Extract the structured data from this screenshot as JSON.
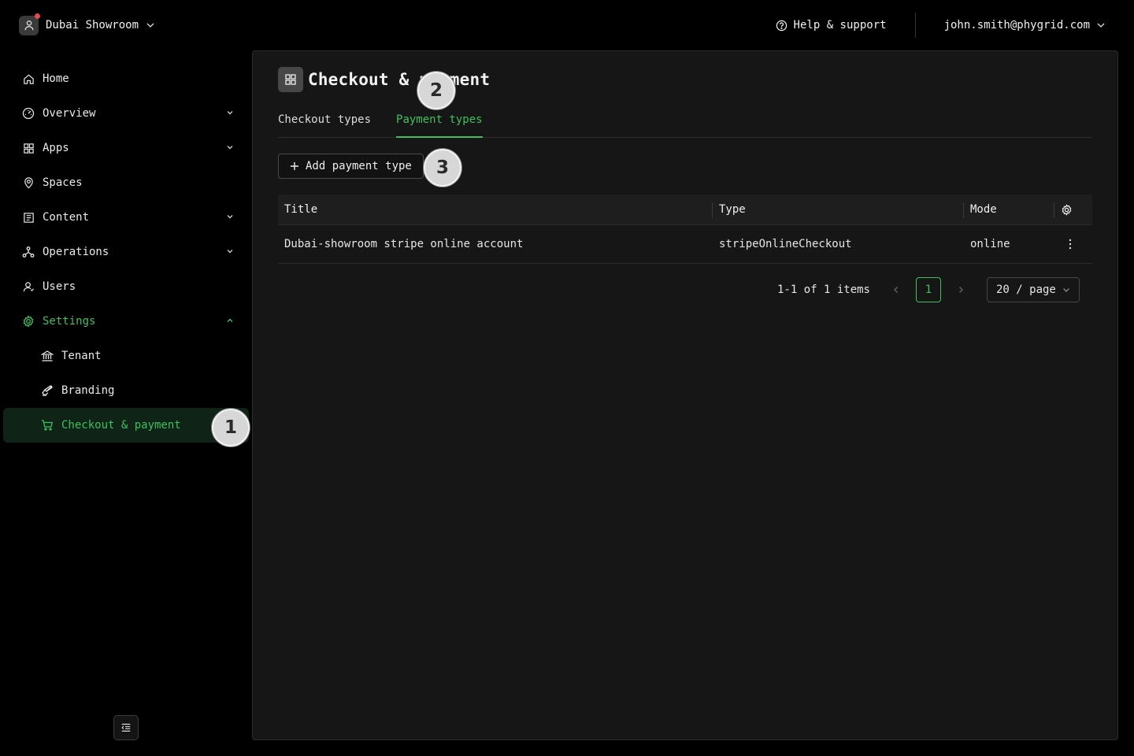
{
  "topbar": {
    "tenant_name": "Dubai Showroom",
    "help_label": "Help & support",
    "user_email": "john.smith@phygrid.com"
  },
  "sidebar": {
    "items": [
      {
        "label": "Home",
        "icon": "home-icon"
      },
      {
        "label": "Overview",
        "icon": "dashboard-icon",
        "expandable": true
      },
      {
        "label": "Apps",
        "icon": "apps-icon",
        "expandable": true
      },
      {
        "label": "Spaces",
        "icon": "location-pin-icon"
      },
      {
        "label": "Content",
        "icon": "content-icon",
        "expandable": true
      },
      {
        "label": "Operations",
        "icon": "operations-icon",
        "expandable": true
      },
      {
        "label": "Users",
        "icon": "users-icon"
      },
      {
        "label": "Settings",
        "icon": "gear-icon",
        "expanded": true
      }
    ],
    "settings_children": [
      {
        "label": "Tenant",
        "icon": "bank-icon"
      },
      {
        "label": "Branding",
        "icon": "brush-icon"
      },
      {
        "label": "Checkout & payment",
        "icon": "cart-icon",
        "active": true
      }
    ]
  },
  "main": {
    "page_title": "Checkout & payment",
    "tabs": [
      {
        "label": "Checkout types",
        "active": false
      },
      {
        "label": "Payment types",
        "active": true
      }
    ],
    "add_button_label": "Add payment type",
    "table": {
      "columns": [
        "Title",
        "Type",
        "Mode"
      ],
      "rows": [
        {
          "title": "Dubai-showroom stripe online account",
          "type": "stripeOnlineCheckout",
          "mode": "online"
        }
      ]
    },
    "pagination": {
      "total_text": "1-1 of 1 items",
      "current_page": "1",
      "page_size": "20 / page"
    }
  },
  "markers": [
    "1",
    "2",
    "3"
  ],
  "colors": {
    "accent": "#3fbf5f",
    "background": "#000000",
    "panel": "#161616",
    "active_nav_bg": "#0f2416",
    "notification_dot": "#e5484d"
  }
}
